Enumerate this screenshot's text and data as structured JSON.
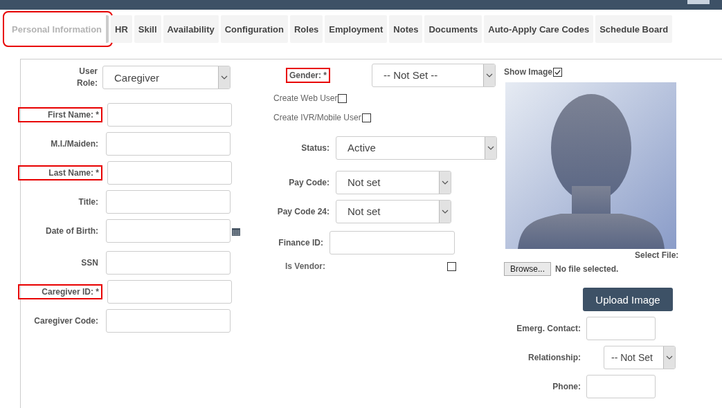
{
  "tabs": [
    {
      "label": "Personal Information",
      "selected": true,
      "highlighted": true
    },
    {
      "label": "HR",
      "selected": false,
      "highlighted": false
    },
    {
      "label": "Skill",
      "selected": false,
      "highlighted": false
    },
    {
      "label": "Availability",
      "selected": false,
      "highlighted": false
    },
    {
      "label": "Configuration",
      "selected": false,
      "highlighted": false
    },
    {
      "label": "Roles",
      "selected": false,
      "highlighted": false
    },
    {
      "label": "Employment",
      "selected": false,
      "highlighted": false
    },
    {
      "label": "Notes",
      "selected": false,
      "highlighted": false
    },
    {
      "label": "Documents",
      "selected": false,
      "highlighted": false
    },
    {
      "label": "Auto-Apply Care Codes",
      "selected": false,
      "highlighted": false
    },
    {
      "label": "Schedule Board",
      "selected": false,
      "highlighted": false
    }
  ],
  "left_fields": [
    {
      "kind": "select",
      "label": "User Role:",
      "value": "Caregiver",
      "highlighted": false
    },
    {
      "kind": "text",
      "label": "First Name: *",
      "highlighted": true
    },
    {
      "kind": "text",
      "label": "M.I./Maiden:",
      "highlighted": false
    },
    {
      "kind": "text",
      "label": "Last Name: *",
      "highlighted": true
    },
    {
      "kind": "text",
      "label": "Title:",
      "highlighted": false
    },
    {
      "kind": "date",
      "label": "Date of Birth:",
      "highlighted": false
    },
    {
      "kind": "text",
      "label": "SSN",
      "highlighted": false
    },
    {
      "kind": "text",
      "label": "Caregiver ID: *",
      "highlighted": true
    },
    {
      "kind": "text",
      "label": "Caregiver Code:",
      "highlighted": false
    }
  ],
  "middle_fields": [
    {
      "kind": "header-select",
      "label": "Gender: *",
      "value": "-- Not Set --",
      "highlighted": true
    },
    {
      "kind": "checkbox",
      "label": "Create Web User",
      "checked": false
    },
    {
      "kind": "checkbox",
      "label": "Create IVR/Mobile User",
      "checked": false
    },
    {
      "kind": "select",
      "label": "Status:",
      "value": "Active",
      "highlighted": false
    },
    {
      "kind": "short-select",
      "label": "Pay Code:",
      "value": "Not set",
      "highlighted": false
    },
    {
      "kind": "short-select",
      "label": "Pay Code 24:",
      "value": "Not set",
      "highlighted": false
    },
    {
      "kind": "text",
      "label": "Finance ID:",
      "highlighted": false
    },
    {
      "kind": "far-checkbox",
      "label": "Is Vendor:",
      "checked": false
    }
  ],
  "image": {
    "label": "Show Image",
    "checked": true,
    "file_label": "Select File:",
    "browse_button": "Browse...",
    "file_status": "No file selected.",
    "upload_button": "Upload Image"
  },
  "contact_fields": [
    {
      "kind": "text",
      "label": "Emerg. Contact:"
    },
    {
      "kind": "select",
      "label": "Relationship:",
      "value": "-- Not Set"
    },
    {
      "kind": "text",
      "label": "Phone:"
    }
  ]
}
